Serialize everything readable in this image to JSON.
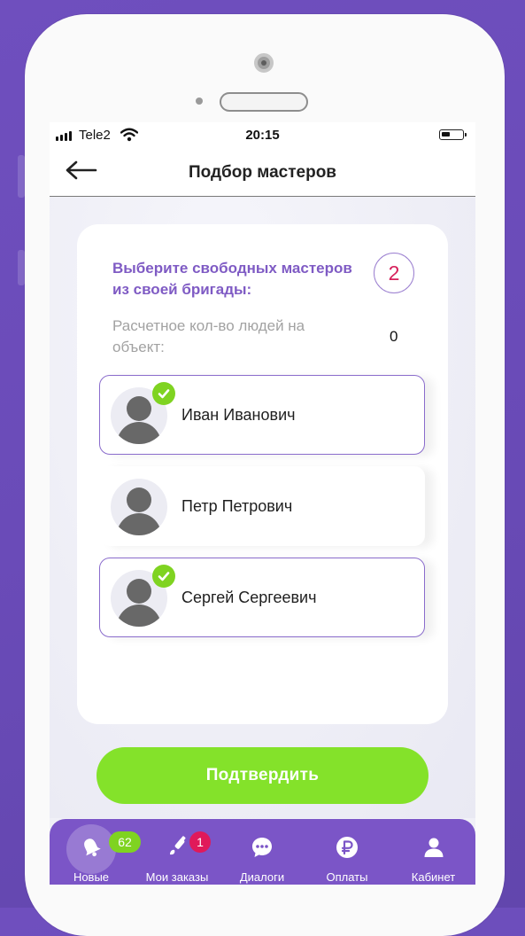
{
  "status_bar": {
    "carrier": "Tele2",
    "time": "20:15"
  },
  "header": {
    "title": "Подбор мастеров"
  },
  "selection": {
    "instruction": "Выберите свободных мастеров из своей бригады:",
    "selected_count": "2",
    "estimate_label": "Расчетное кол-во людей на объект:",
    "estimate_value": "0"
  },
  "masters": [
    {
      "name": "Иван Иванович",
      "selected": true
    },
    {
      "name": "Петр Петрович",
      "selected": false
    },
    {
      "name": "Сергей Сергеевич",
      "selected": true
    }
  ],
  "confirm_label": "Подтвердить",
  "tabs": [
    {
      "label": "Новые",
      "icon": "bell-icon",
      "badge": "62",
      "active": true
    },
    {
      "label": "Мои заказы",
      "icon": "brush-icon",
      "badge": "1",
      "active": false
    },
    {
      "label": "Диалоги",
      "icon": "chat-icon",
      "active": false
    },
    {
      "label": "Оплаты",
      "icon": "ruble-icon",
      "active": false
    },
    {
      "label": "Кабинет",
      "icon": "person-icon",
      "active": false
    }
  ],
  "colors": {
    "accent_purple": "#7b55c7",
    "confirm_green": "#84e22a",
    "check_green": "#7fd321",
    "count_red": "#d6215b",
    "badge_red": "#e0195a"
  }
}
